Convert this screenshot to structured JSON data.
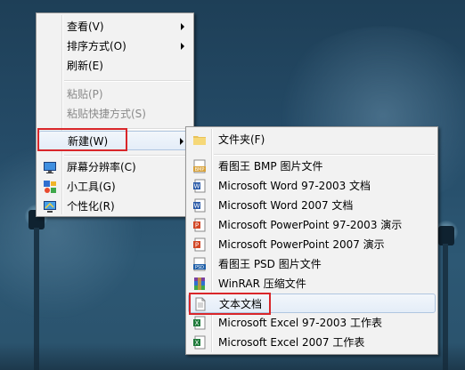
{
  "context_menu": {
    "items": [
      {
        "label": "查看(V)",
        "icon": null,
        "submenu": true,
        "disabled": false
      },
      {
        "label": "排序方式(O)",
        "icon": null,
        "submenu": true,
        "disabled": false
      },
      {
        "label": "刷新(E)",
        "icon": null,
        "submenu": false,
        "disabled": false
      },
      {
        "label": "粘贴(P)",
        "icon": null,
        "submenu": false,
        "disabled": true
      },
      {
        "label": "粘贴快捷方式(S)",
        "icon": null,
        "submenu": false,
        "disabled": true
      },
      {
        "label": "新建(W)",
        "icon": null,
        "submenu": true,
        "disabled": false,
        "highlighted": true
      },
      {
        "label": "屏幕分辨率(C)",
        "icon": "display-icon",
        "submenu": false,
        "disabled": false
      },
      {
        "label": "小工具(G)",
        "icon": "gadgets-icon",
        "submenu": false,
        "disabled": false
      },
      {
        "label": "个性化(R)",
        "icon": "personalize-icon",
        "submenu": false,
        "disabled": false
      }
    ]
  },
  "new_submenu": {
    "items": [
      {
        "label": "文件夹(F)",
        "icon": "folder-icon"
      },
      {
        "label": "看图王 BMP 图片文件",
        "icon": "bmp-file-icon"
      },
      {
        "label": "Microsoft Word 97-2003 文档",
        "icon": "word-doc-icon"
      },
      {
        "label": "Microsoft Word 2007 文档",
        "icon": "word-docx-icon"
      },
      {
        "label": "Microsoft PowerPoint 97-2003 演示",
        "icon": "powerpoint-ppt-icon"
      },
      {
        "label": "Microsoft PowerPoint 2007 演示",
        "icon": "powerpoint-pptx-icon"
      },
      {
        "label": "看图王 PSD 图片文件",
        "icon": "psd-file-icon"
      },
      {
        "label": "WinRAR 压缩文件",
        "icon": "winrar-icon"
      },
      {
        "label": "文本文档",
        "icon": "text-document-icon",
        "hovered": true
      },
      {
        "label": "Microsoft Excel 97-2003 工作表",
        "icon": "excel-xls-icon"
      },
      {
        "label": "Microsoft Excel 2007 工作表",
        "icon": "excel-xlsx-icon"
      }
    ]
  },
  "colors": {
    "highlight_border": "#d9262a",
    "menu_background": "#f2f2f2",
    "disabled_text": "#8a8a8a"
  }
}
